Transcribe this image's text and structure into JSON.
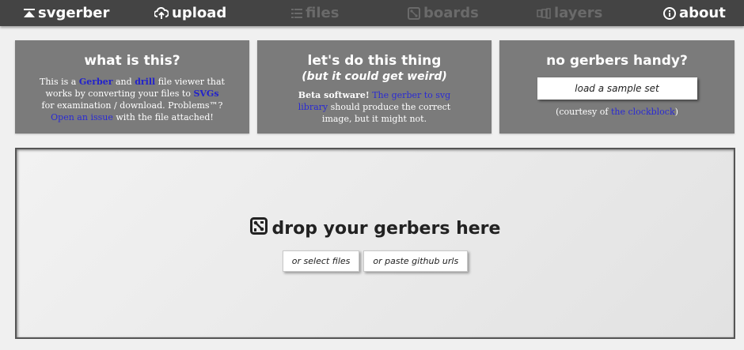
{
  "nav": {
    "brand": "svgerber",
    "upload": "upload",
    "files": "files",
    "boards": "boards",
    "layers": "layers",
    "about": "about"
  },
  "icons": {
    "brand": "eject-icon",
    "upload": "cloud-upload-icon",
    "files": "list-icon",
    "boards": "board-icon",
    "layers": "layers-icon",
    "about": "info-icon",
    "drop": "board-icon"
  },
  "colors": {
    "nav_bg": "#444444",
    "nav_disabled": "#6a6a6a",
    "card_bg": "#7b7b7b",
    "link": "#2a2ad4"
  },
  "card_what": {
    "title": "what is this?",
    "t1": "This is a ",
    "link_gerber": "Gerber",
    "t2": " and ",
    "link_drill": "drill",
    "t3": " file viewer that works by converting your files to ",
    "link_svgs": "SVGs",
    "t4": " for examination / download. Problems™? ",
    "link_issue": "Open an issue",
    "t5": " with the file attached!"
  },
  "card_do": {
    "title": "let's do this thing",
    "subtitle": "(but it could get weird)",
    "beta": "Beta software!",
    "link_library": "The gerber to svg library",
    "t1": " should produce the correct image, but it might not."
  },
  "card_sample": {
    "title": "no gerbers handy?",
    "button": "load a sample set",
    "c1": "(courtesy of ",
    "link_clockblock": "the clockblock",
    "c2": ")"
  },
  "dropzone": {
    "title": "drop your gerbers here",
    "select_files": "or select files",
    "paste_urls": "or paste github urls"
  }
}
